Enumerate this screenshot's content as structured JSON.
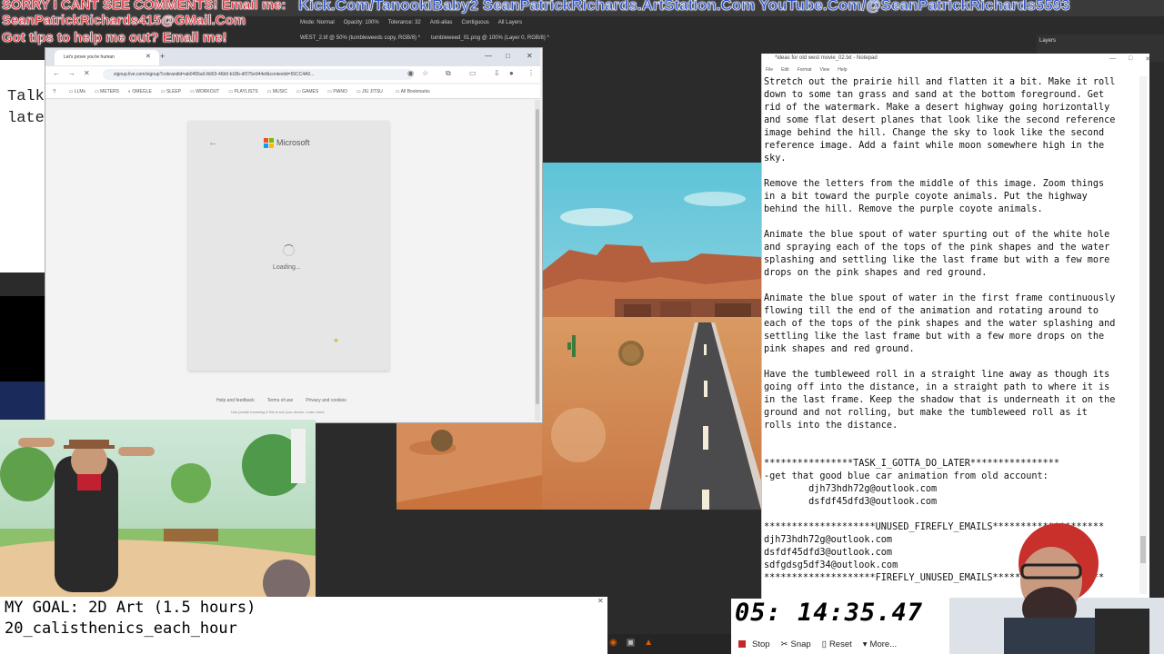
{
  "overlay": {
    "sorry": "SORRY I CANT SEE COMMENTS! Email me:",
    "links": "Kick.Com/TanookiBaby2 SeanPatrickRichards.ArtStation.Com YouTube.Com/@SeanPatrickRichards5593",
    "email": "SeanPatrickRichards415@GMail.Com",
    "tips": "Got tips to help me out? Email me!"
  },
  "photoshop": {
    "options": [
      "Mode: Normal",
      "Opacity: 100%",
      "Tolerance: 32",
      "Anti-alias",
      "Contiguous",
      "All Layers"
    ],
    "doc_tabs": [
      "WEST_2.tif @ 50% (tumbleweeds copy, RGB/8) *",
      "tumbleweed_01.png @ 100% (Layer 0, RGB/8) *"
    ],
    "panel_label": "Layers"
  },
  "left_notepad": {
    "line1": "Talk",
    "line2": "late"
  },
  "browser": {
    "tab_title": "Let's prove you're human",
    "url": "signup.live.com/signup?cobrandid=ab0455a0-8d03-46b9-b18b-df275e944ef&contextid=55CC4A0...",
    "bookmarks": [
      "LLMs",
      "METERS",
      "OMEGLE",
      "SLEEP",
      "WORKOUT",
      "PLAYLISTS",
      "MUSIC",
      "GAMES",
      "PIANO",
      "JIU JITSU"
    ],
    "all_bookmarks": "All Bookmarks"
  },
  "ms_card": {
    "brand": "Microsoft",
    "loading": "Loading...",
    "footer_links": [
      "Help and feedback",
      "Terms of use",
      "Privacy and cookies"
    ],
    "footer_note": "Use private browsing if this is not your device. Learn more"
  },
  "notepad": {
    "title": "*ideas for old west movie_02.txt - Notepad",
    "menu": [
      "File",
      "Edit",
      "Format",
      "View",
      "Help"
    ],
    "lines": [
      "Stretch out the prairie hill and flatten it a bit. Make it roll",
      "down to some tan grass and sand at the bottom foreground. Get",
      "rid of the watermark. Make a desert highway going horizontally",
      "and some flat desert planes that look like the second reference",
      "image behind the hill. Change the sky to look like the second",
      "reference image. Add a faint while moon somewhere high in the",
      "sky.",
      "",
      "Remove the letters from the middle of this image. Zoom things",
      "in a bit toward the purple coyote animals. Put the highway",
      "behind the hill. Remove the purple coyote animals.",
      "",
      "Animate the blue spout of water spurting out of the white hole",
      "and spraying each of the tops of the pink shapes and the water",
      "splashing and settling like the last frame but with a few more",
      "drops on the pink shapes and red ground.",
      "",
      "Animate the blue spout of water in the first frame continuously",
      "flowing till the end of the animation and rotating around to",
      "each of the tops of the pink shapes and the water splashing and",
      "settling like the last frame but with a few more drops on the",
      "pink shapes and red ground.",
      "",
      "Have the tumbleweed roll in a straight line away as though its",
      "going off into the distance, in a straight path to where it is",
      "in the last frame. Keep the shadow that is underneath it on the",
      "ground and not rolling, but make the tumbleweed roll as it",
      "rolls into the distance.",
      "",
      "",
      "****************TASK_I_GOTTA_DO_LATER****************",
      "-get that good blue car animation from old account:",
      "        djh73hdh72g@outlook.com",
      "        dsfdf45dfd3@outlook.com",
      "",
      "********************UNUSED_FIREFLY_EMAILS********************",
      "djh73hdh72g@outlook.com",
      "dsfdf45dfd3@outlook.com",
      "sdfgdsg5df34@outlook.com",
      "********************FIREFLY_UNUSED_EMAILS********************"
    ]
  },
  "goal": {
    "line1": "MY GOAL: 2D Art (1.5 hours)",
    "line2": "20_calisthenics_each_hour"
  },
  "stopwatch": {
    "time": "05: 14:35.47",
    "buttons": [
      "Stop",
      "Snap",
      "Reset",
      "More..."
    ]
  },
  "colors": {
    "overlay_red": "#e0202a",
    "overlay_blue": "#2f54c8",
    "stop_red": "#c62828"
  }
}
